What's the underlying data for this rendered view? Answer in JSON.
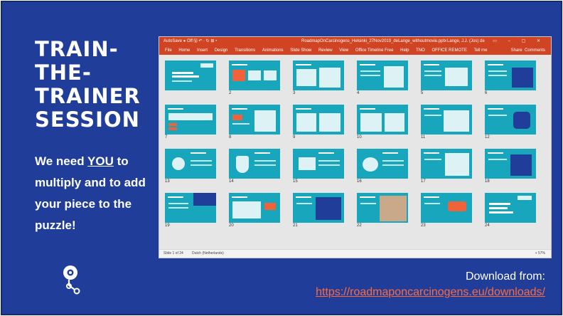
{
  "slide": {
    "title_lines": [
      "TRAIN-",
      "THE-",
      "TRAINER",
      "SESSION"
    ],
    "body": {
      "part1": "We need ",
      "emph": "YOU",
      "part2": " to multiply and to add your piece to the puzzle!"
    },
    "download_label": "Download from:",
    "download_url": "https://roadmaponcarcinogens.eu/downloads/",
    "logo_icon": "roadmap-logo-icon"
  },
  "ppt": {
    "quick_access": "AutoSave  ● Off  🖫  ↶ · ↻  ⊞  ▾",
    "filename": "RoadmapOnCarcinogens_Helsinki_27Nov2019_deLange_withoutmovie.pptx",
    "user": "Lange, J.J. (Jos) de",
    "tabs": [
      "File",
      "Home",
      "Insert",
      "Design",
      "Transitions",
      "Animations",
      "Slide Show",
      "Review",
      "View",
      "Office Timeline Free",
      "Help",
      "TNO",
      "OFFICE REMOTE",
      "Tell me"
    ],
    "share": "Share",
    "comments": "Comments",
    "status_left": "Slide 1 of 24",
    "status_lang": "Dutch (Netherlands)",
    "status_zoom": "+ 57%",
    "thumb_labels": [
      "2",
      "3",
      "4",
      "5",
      "6",
      "7",
      "8",
      "9",
      "10",
      "11",
      "12",
      "13",
      "14",
      "15",
      "16",
      "17",
      "18",
      "19",
      "20",
      "21",
      "22",
      "23",
      "24"
    ]
  },
  "colors": {
    "slide_bg": "#1f3d99",
    "accent_link": "#ff6a3c",
    "ppt_ribbon": "#d04423",
    "thumb_teal": "#17a6bb"
  }
}
